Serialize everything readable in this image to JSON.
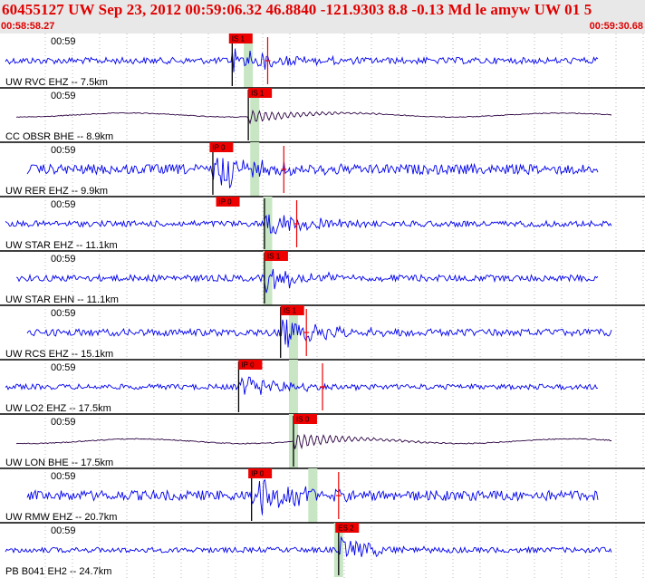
{
  "header": {
    "title": "60455127 UW Sep 23, 2012 00:59:06.32   46.8840 -121.9303  8.8 -0.13 Md le amyw UW 01   5",
    "time_start": "00:58:58.27",
    "time_end": "00:59:30.68"
  },
  "tick_label": "00:59",
  "colors": {
    "trace_short": "#0000ee",
    "trace_broadband": "#2a0040",
    "pick_box": "#ee0000",
    "marker": "#c8e6c4",
    "grid": "#000000"
  },
  "traces": [
    {
      "station": "UW RVC EHZ -- 7.5km",
      "kind": "short",
      "amplitude": 0.55,
      "pick": "IS 1",
      "pick_time": 0.355,
      "onset": 0.36,
      "marker_time": 0.385,
      "sec_mark": 0.415
    },
    {
      "station": "CC OBSR BHE -- 8.9km",
      "kind": "broadband",
      "amplitude": 0.3,
      "pick": "IS 1",
      "pick_time": 0.385,
      "onset": 0.385,
      "marker_time": 0.395,
      "sec_mark": null
    },
    {
      "station": "UW RER EHZ -- 9.9km",
      "kind": "short",
      "amplitude": 0.85,
      "pick": "IP 0",
      "pick_time": 0.325,
      "onset": 0.33,
      "marker_time": 0.395,
      "sec_mark": 0.44
    },
    {
      "station": "UW STAR EHZ -- 11.1km",
      "kind": "short",
      "amplitude": 0.5,
      "pick": "IP 0",
      "pick_time": 0.335,
      "onset": 0.41,
      "marker_time": 0.415,
      "sec_mark": 0.46
    },
    {
      "station": "UW STAR EHN -- 11.1km",
      "kind": "short",
      "amplitude": 0.55,
      "pick": "IS 1",
      "pick_time": 0.41,
      "onset": 0.41,
      "marker_time": 0.415,
      "sec_mark": null
    },
    {
      "station": "UW RCS EHZ -- 15.1km",
      "kind": "short",
      "amplitude": 0.6,
      "pick": "IS 1",
      "pick_time": 0.435,
      "onset": 0.435,
      "marker_time": 0.455,
      "sec_mark": 0.475
    },
    {
      "station": "UW LO2 EHZ -- 17.5km",
      "kind": "short",
      "amplitude": 0.45,
      "pick": "IP 0",
      "pick_time": 0.37,
      "onset": 0.37,
      "marker_time": 0.455,
      "sec_mark": 0.5
    },
    {
      "station": "UW LON BHE -- 17.5km",
      "kind": "broadband",
      "amplitude": 0.35,
      "pick": "IS 0",
      "pick_time": 0.455,
      "onset": 0.455,
      "marker_time": 0.455,
      "sec_mark": null
    },
    {
      "station": "UW RMW EHZ -- 20.7km",
      "kind": "short",
      "amplitude": 0.85,
      "pick": "IP 0",
      "pick_time": 0.385,
      "onset": 0.39,
      "marker_time": 0.485,
      "sec_mark": 0.525
    },
    {
      "station": "PB B041 EH2 -- 24.7km",
      "kind": "short",
      "amplitude": 0.45,
      "pick": "ES 2",
      "pick_time": 0.52,
      "onset": 0.525,
      "marker_time": 0.525,
      "sec_mark": null
    }
  ]
}
